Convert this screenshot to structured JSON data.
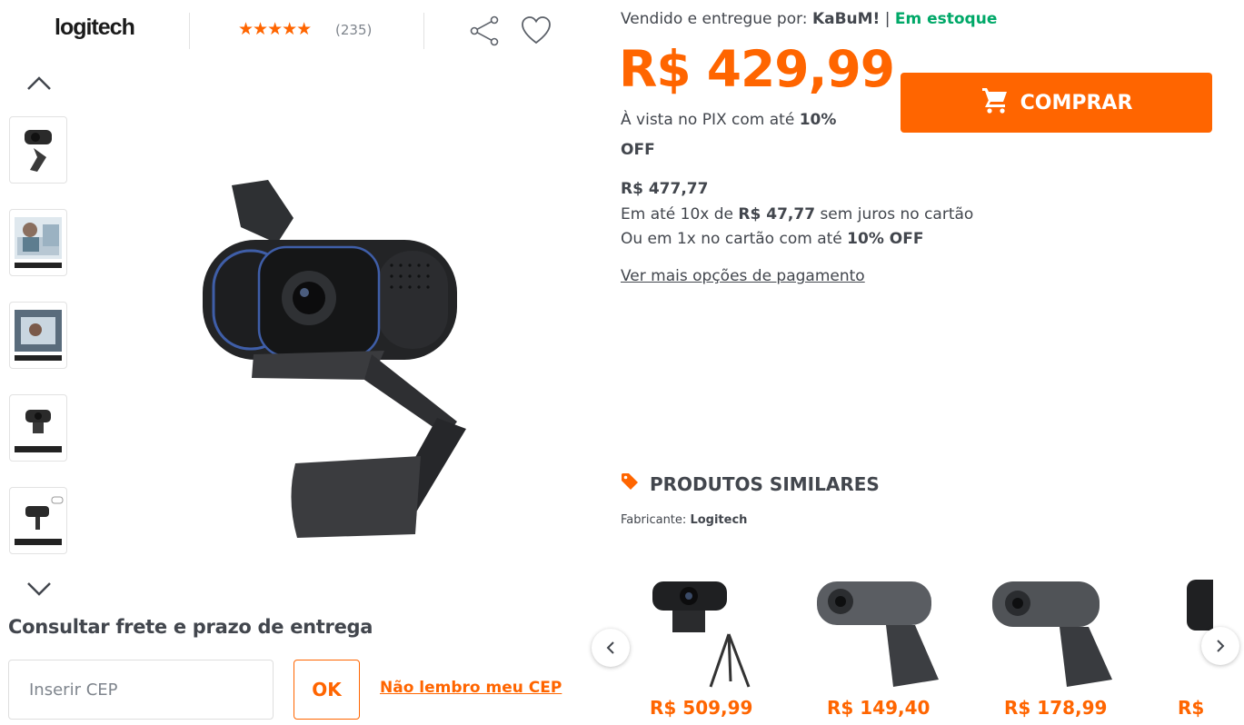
{
  "header": {
    "brand": "logitech",
    "rating_stars": "★★★★★",
    "reviews": "(235)"
  },
  "shipping": {
    "title": "Consultar frete e prazo de entrega",
    "cep_placeholder": "Inserir CEP",
    "ok_label": "OK",
    "forgot_label": "Não lembro meu CEP"
  },
  "offer": {
    "seller_prefix": "Vendido e entregue por:",
    "seller_name": "KaBuM!",
    "separator": "|",
    "stock": "Em estoque",
    "price": "R$ 429,99",
    "pix_prefix": "À vista no PIX com até",
    "pix_discount": "10% OFF",
    "buy_label": "COMPRAR",
    "old_price": "R$ 477,77",
    "installments_prefix": "Em até 10x de",
    "installment_value": "R$ 47,77",
    "installments_suffix": "sem juros no cartão",
    "card_prefix": "Ou em 1x no cartão com até",
    "card_discount": "10% OFF",
    "more_payment": "Ver mais opções de pagamento"
  },
  "similar": {
    "title": "PRODUTOS SIMILARES",
    "maker_prefix": "Fabricante:",
    "maker": "Logitech",
    "products": [
      {
        "price": "R$ 509,99"
      },
      {
        "price": "R$ 149,40"
      },
      {
        "price": "R$ 178,99"
      },
      {
        "price": "R$ "
      }
    ]
  },
  "colors": {
    "accent": "#ff6500",
    "stock": "#00a868",
    "text": "#42464d"
  },
  "icons": [
    "share-icon",
    "heart-icon",
    "chevron-up-icon",
    "chevron-down-icon",
    "cart-icon",
    "tag-icon",
    "chevron-left-icon",
    "chevron-right-icon"
  ]
}
